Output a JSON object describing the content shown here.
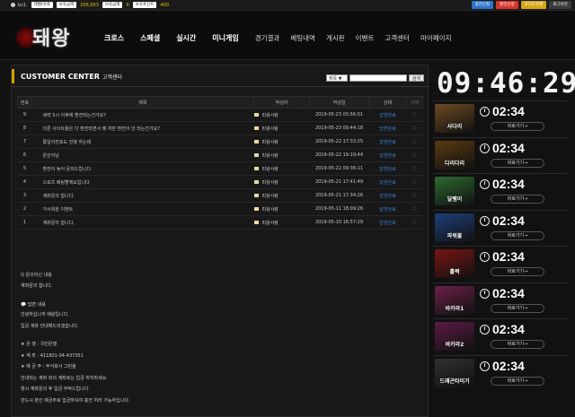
{
  "topbar": {
    "user_name": "bs1.",
    "box1": "레벨/이력",
    "money_label": "보유금액",
    "money_value": "206,003",
    "point_label": "보유금액",
    "point_value": "0",
    "chip_label": "보유포인트",
    "chip_value": "400",
    "buttons": [
      {
        "label": "충전신청",
        "color": "#2d73c9"
      },
      {
        "label": "환전신청",
        "color": "#d9342a"
      },
      {
        "label": "포인트전환",
        "color": "#d6a514"
      },
      {
        "label": "로그아웃",
        "color": "#3b3b3b"
      }
    ]
  },
  "logo": {
    "text": "돼왕"
  },
  "nav": {
    "items": [
      "크로스",
      "스페셜",
      "실시간",
      "미니게임",
      "경기결과",
      "베팅내역",
      "게시판",
      "이벤트",
      "고객센터",
      "마이페이지"
    ]
  },
  "center": {
    "title": "CUSTOMER CENTER",
    "subtitle": "고객센터",
    "search_select": "제목 ▼",
    "search_button": "검색",
    "columns": [
      "번호",
      "제목",
      "작성자",
      "작성일",
      "상태",
      "삭제"
    ],
    "rows": [
      {
        "no": "9",
        "title": "세력 5시 이후에 환전되는건가요?",
        "author": "피왕사랑",
        "date": "2019-05-23 03:56:01",
        "state": "답변완료",
        "del": "○"
      },
      {
        "no": "8",
        "title": "다른 사이트들은 다 환전되면서 왜 저만 환전이 안 되는건가요?",
        "author": "피왕사랑",
        "date": "2019-05-23 00:44:18",
        "state": "답변완료",
        "del": "○"
      },
      {
        "no": "7",
        "title": "통일이전포도 진행 하는데",
        "author": "피왕사랑",
        "date": "2019-05-22 17:33:25",
        "state": "답변완료",
        "del": "○"
      },
      {
        "no": "6",
        "title": "온안지남",
        "author": "피왕사랑",
        "date": "2019-05-22 19:19:44",
        "state": "답변완료",
        "del": "○"
      },
      {
        "no": "5",
        "title": "환전이 늦어 문의드립니다",
        "author": "피왕사랑",
        "date": "2019-05-22 09:36:11",
        "state": "답변완료",
        "del": "○"
      },
      {
        "no": "4",
        "title": "스포츠 베팅할께요입니다",
        "author": "피왕사랑",
        "date": "2019-05-21 17:41:49",
        "state": "답변완료",
        "del": "○"
      },
      {
        "no": "3",
        "title": "계좌문의 합니다.",
        "author": "피왕사랑",
        "date": "2019-05-21 17:34:26",
        "state": "답변완료",
        "del": "○"
      },
      {
        "no": "2",
        "title": "가사회원 이벤트",
        "author": "피왕사랑",
        "date": "2019-05-11 18:09:26",
        "state": "답변완료",
        "del": "○"
      },
      {
        "no": "1",
        "title": "계좌문의 합니다.",
        "author": "피왕사랑",
        "date": "2019-05-10 16:57:29",
        "state": "답변완료",
        "del": "○"
      }
    ],
    "detail": {
      "q_label": "Q 문의하신 내용",
      "q_text": "계좌문의 합니다.",
      "a_label": "💬 답변 내용",
      "lines": [
        "안녕하십니까 배왕입니다.",
        "입금 계좌 안내해드리겠습니다.",
        "",
        "★ 은 행 : 국민은행",
        "★ 계 좌 : 411801-04-437351",
        "★ 예 금 주 : 주식회사 그린울",
        "안내되는 계좌 외의 계좌로는 입금 하지마세요.",
        "항시 계좌문의 후 입금 부탁드립니다.",
        "반드시 본인 예금주로 입금하셔야 충전 처리 가능하십니다."
      ]
    }
  },
  "sidebar": {
    "clock": "09:46:29",
    "go_label": "바로가기→",
    "games": [
      {
        "name": "사다리",
        "time": "02:34",
        "color": "#6b4a22"
      },
      {
        "name": "다리다리",
        "time": "02:34",
        "color": "#5a3a10"
      },
      {
        "name": "달팽이",
        "time": "02:34",
        "color": "#2d6a30"
      },
      {
        "name": "파워볼",
        "time": "02:34",
        "color": "#1f3f7a"
      },
      {
        "name": "홀짝",
        "time": "02:34",
        "color": "#7a1414"
      },
      {
        "name": "바카라1",
        "time": "02:34",
        "color": "#6a2048"
      },
      {
        "name": "바카라2",
        "time": "02:34",
        "color": "#5a1a44"
      },
      {
        "name": "드래곤타이거",
        "time": "02:34",
        "color": "#303030"
      }
    ]
  }
}
